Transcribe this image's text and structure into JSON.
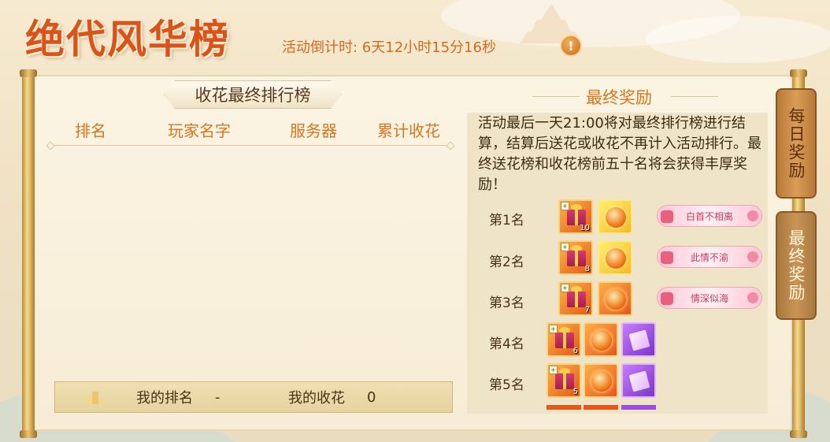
{
  "header": {
    "title": "绝代风华榜",
    "countdown": "活动倒计时: 6天12小时15分16秒",
    "info_icon": "!"
  },
  "ranking": {
    "title": "收花最终排行榜",
    "columns": [
      "排名",
      "玩家名字",
      "服务器",
      "累计收花"
    ],
    "rows": [],
    "my_rank_label": "我的排名",
    "my_rank_value": "-",
    "my_flowers_label": "我的收花",
    "my_flowers_value": "0"
  },
  "reward": {
    "title": "最终奖励",
    "description": "活动最后一天21:00将对最终排行榜进行结算，结算后送花或收花不再计入活动排行。最终送花榜和收花榜前五十名将会获得丰厚奖励！",
    "tiers": [
      {
        "rank": "第1名",
        "gift_count": "10",
        "title_badge": "白首不相离"
      },
      {
        "rank": "第2名",
        "gift_count": "8",
        "title_badge": "此情不渝"
      },
      {
        "rank": "第3名",
        "gift_count": "7",
        "title_badge": "情深似海"
      },
      {
        "rank": "第4名",
        "gift_count": "6"
      },
      {
        "rank": "第5名",
        "gift_count": "5"
      }
    ]
  },
  "tabs": {
    "daily": "每日奖励",
    "final": "最终奖励"
  },
  "colors": {
    "accent": "#d8761f",
    "title": "#d9531a",
    "panel": "#fbf4e3"
  }
}
